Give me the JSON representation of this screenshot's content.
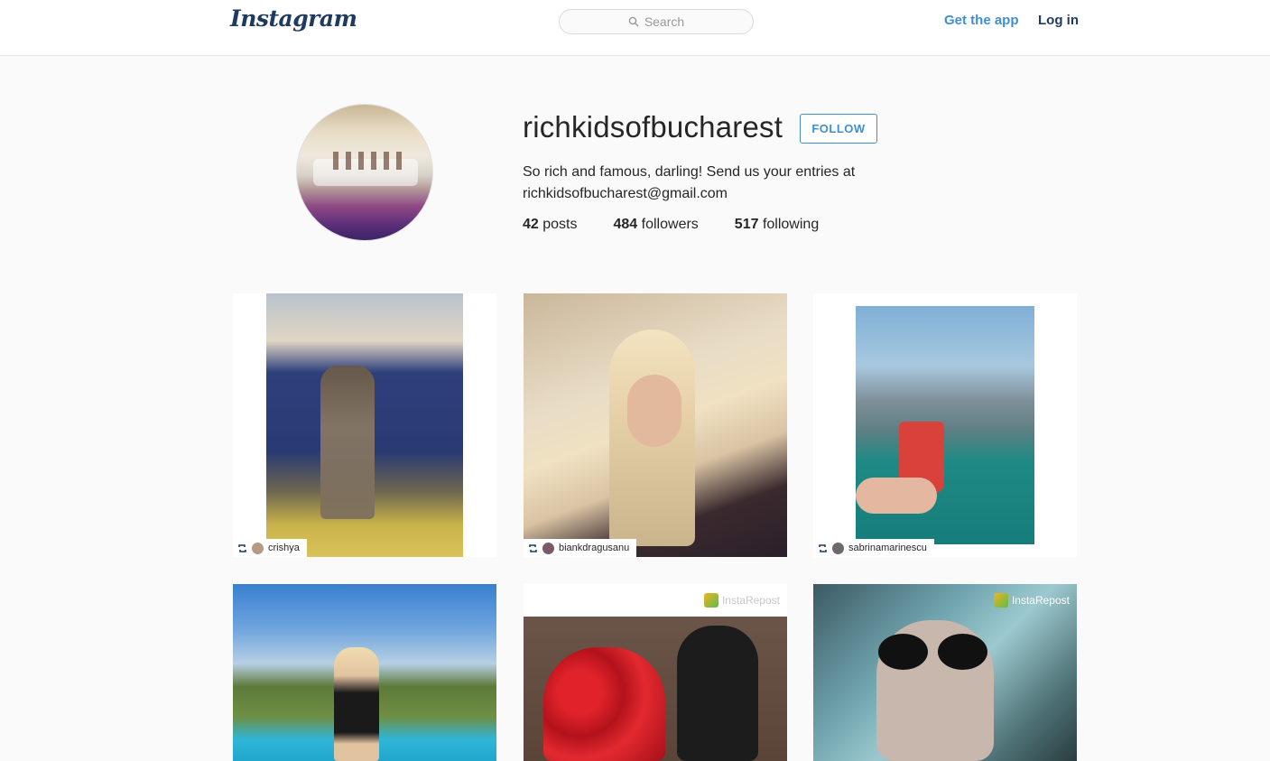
{
  "header": {
    "logo": "Instagram",
    "search_placeholder": "Search",
    "get_app": "Get the app",
    "login": "Log in"
  },
  "profile": {
    "username": "richkidsofbucharest",
    "follow_label": "FOLLOW",
    "bio_line1": "So rich and famous, darling! Send us your entries at",
    "bio_line2": "richkidsofbucharest@gmail.com",
    "posts_count": "42",
    "posts_label": "posts",
    "followers_count": "484",
    "followers_label": "followers",
    "following_count": "517",
    "following_label": "following"
  },
  "posts": [
    {
      "repost_user": "crishya"
    },
    {
      "repost_user": "biankdragusanu"
    },
    {
      "repost_user": "sabrinamarinescu"
    },
    {
      "repost_user": ""
    },
    {
      "watermark": "InstaRepost"
    },
    {
      "watermark": "InstaRepost"
    }
  ],
  "colors": {
    "accent": "#3f8fd2",
    "brand": "#1f3a5f"
  }
}
